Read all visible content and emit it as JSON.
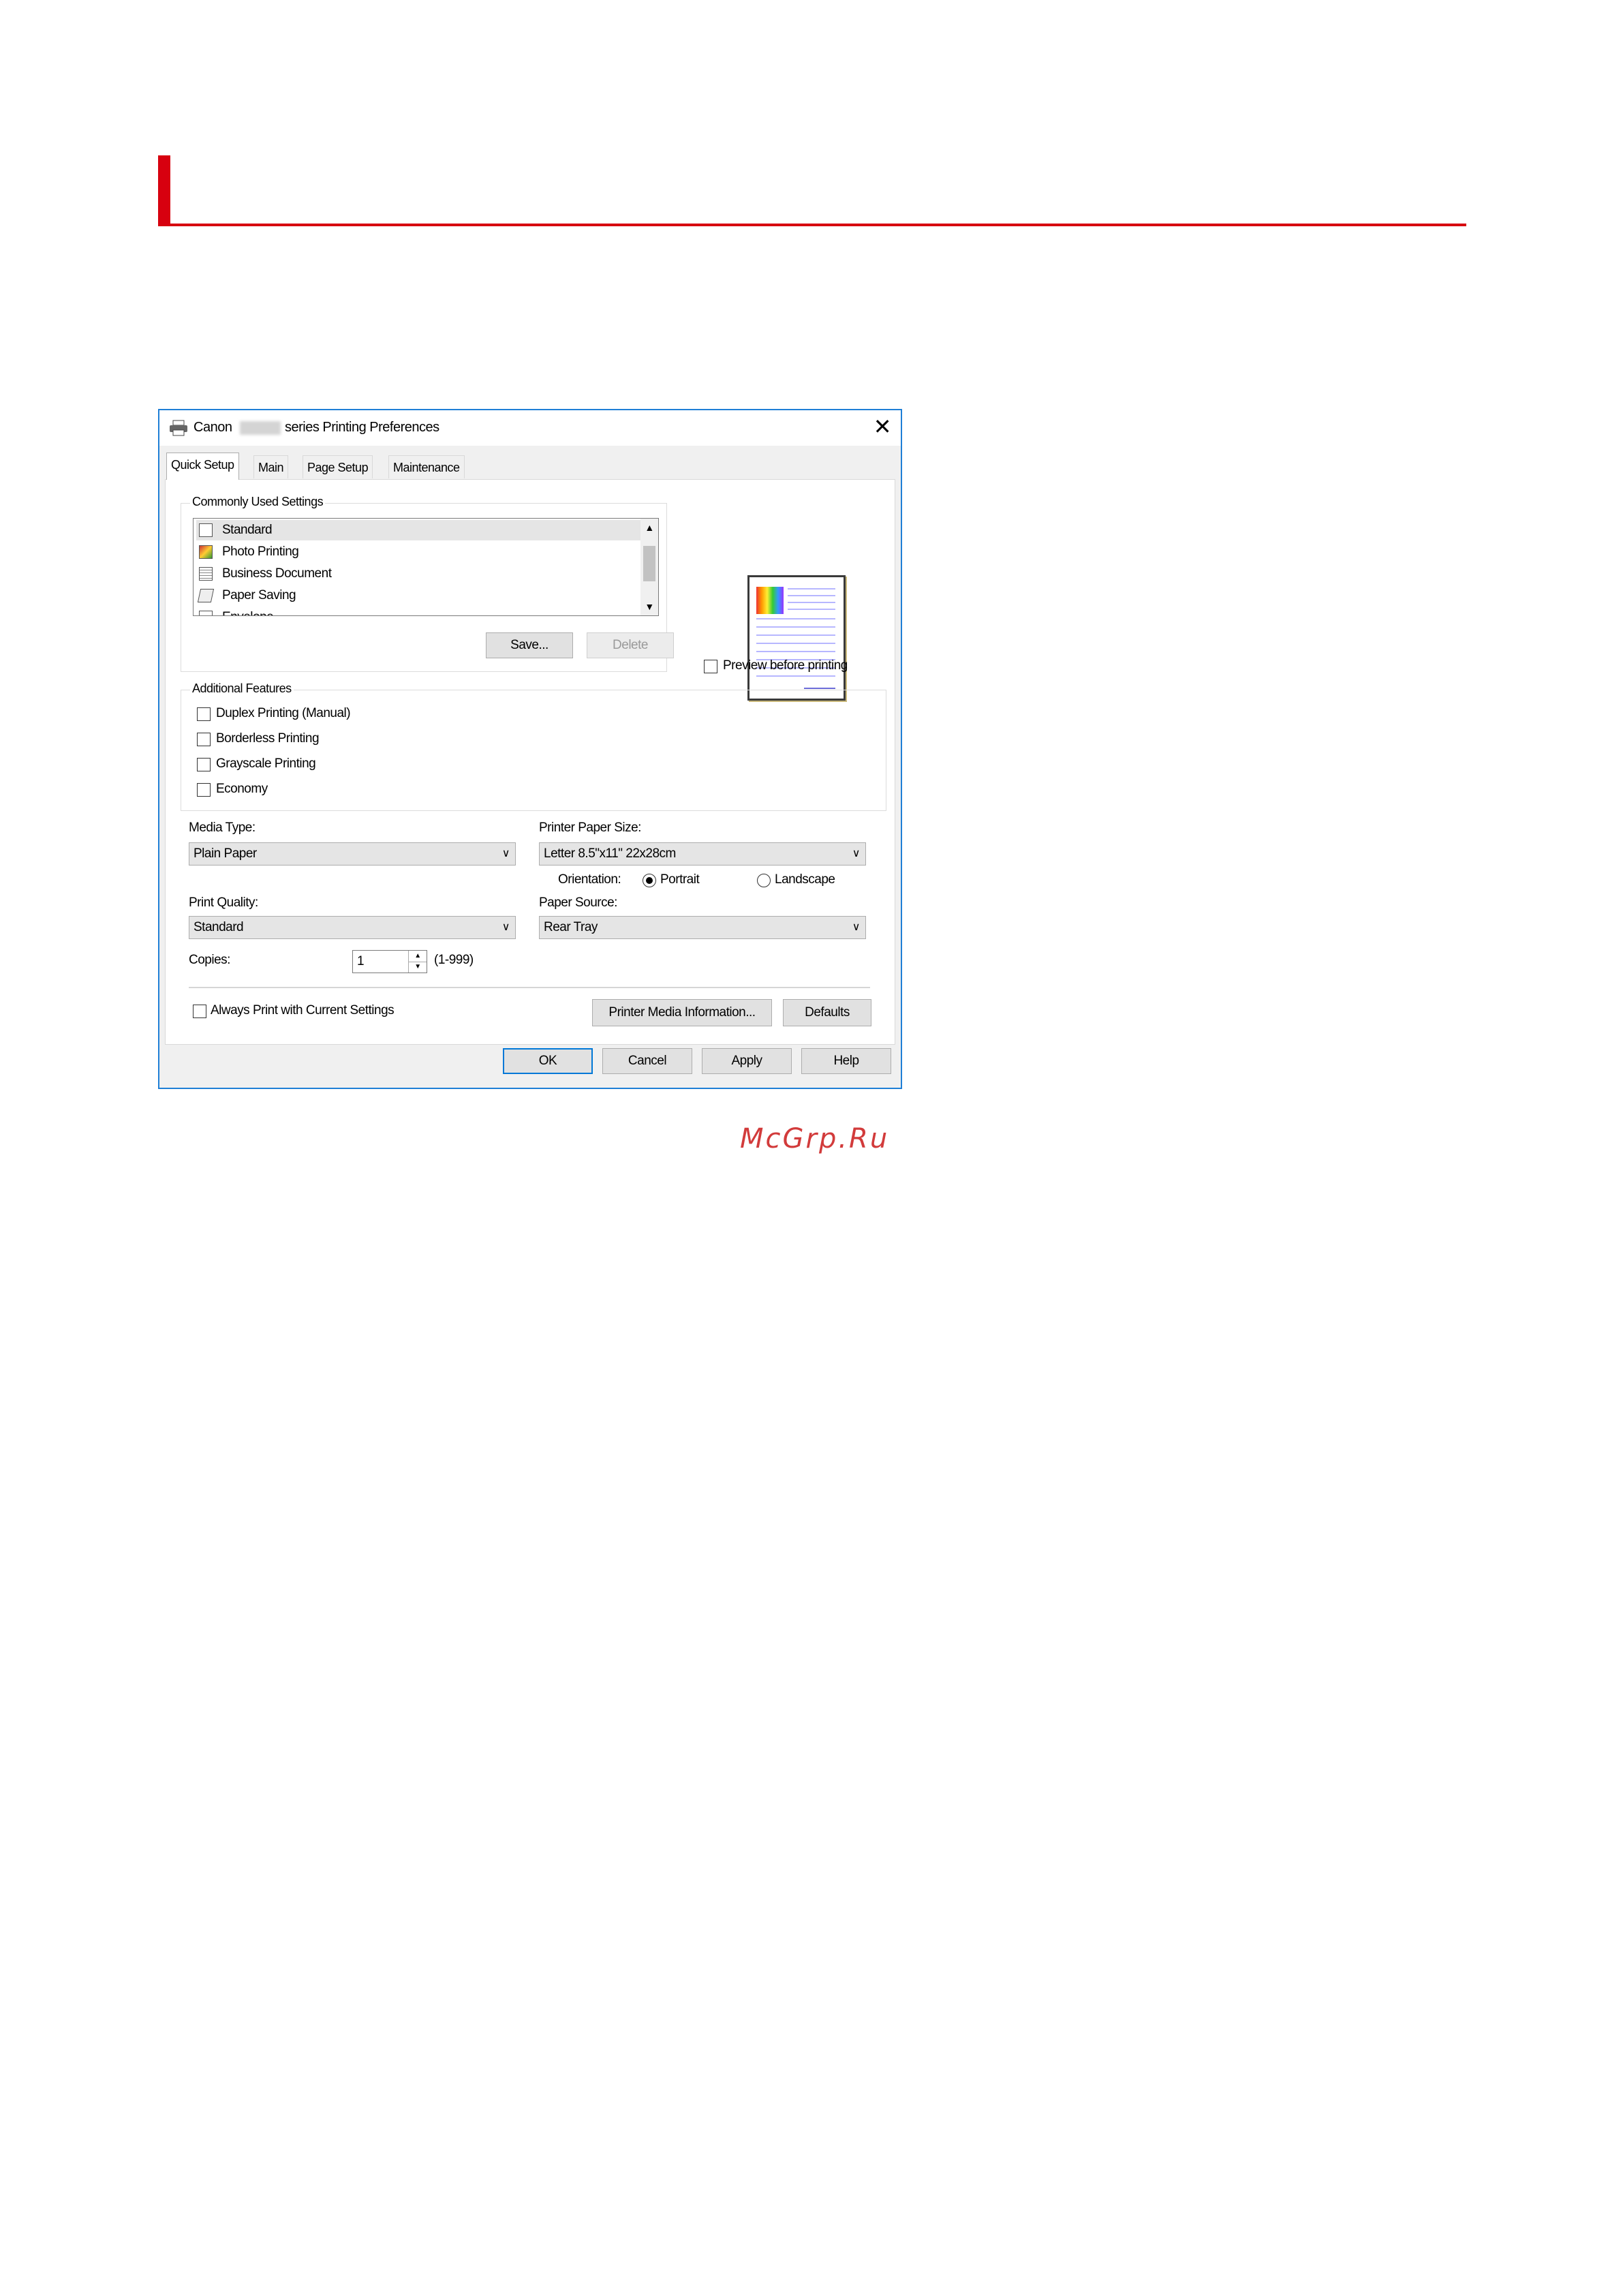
{
  "dialog": {
    "title_prefix": "Canon",
    "title_suffix": "series Printing Preferences",
    "close_glyph": "✕",
    "tabs": [
      {
        "label": "Quick Setup",
        "active": true
      },
      {
        "label": "Main",
        "active": false
      },
      {
        "label": "Page Setup",
        "active": false
      },
      {
        "label": "Maintenance",
        "active": false
      }
    ],
    "commonly_used": {
      "title": "Commonly Used Settings",
      "items": [
        {
          "label": "Standard",
          "icon": "standard-doc-icon",
          "selected": true
        },
        {
          "label": "Photo Printing",
          "icon": "photo-icon",
          "selected": false
        },
        {
          "label": "Business Document",
          "icon": "business-doc-icon",
          "selected": false
        },
        {
          "label": "Paper Saving",
          "icon": "paper-saving-icon",
          "selected": false
        },
        {
          "label": "Envelope",
          "icon": "envelope-icon",
          "selected": false
        }
      ],
      "save_label": "Save...",
      "delete_label": "Delete"
    },
    "preview_before_printing": "Preview before printing",
    "additional_features": {
      "title": "Additional Features",
      "items": [
        {
          "label": "Duplex Printing (Manual)",
          "checked": false
        },
        {
          "label": "Borderless Printing",
          "checked": false
        },
        {
          "label": "Grayscale Printing",
          "checked": false
        },
        {
          "label": "Economy",
          "checked": false
        }
      ]
    },
    "media_type": {
      "label": "Media Type:",
      "value": "Plain Paper"
    },
    "paper_size": {
      "label": "Printer Paper Size:",
      "value": "Letter 8.5\"x11\" 22x28cm"
    },
    "orientation": {
      "label": "Orientation:",
      "portrait": "Portrait",
      "landscape": "Landscape",
      "selected": "Portrait"
    },
    "print_quality": {
      "label": "Print Quality:",
      "value": "Standard"
    },
    "paper_source": {
      "label": "Paper Source:",
      "value": "Rear Tray"
    },
    "copies": {
      "label": "Copies:",
      "value": "1",
      "range": "(1-999)"
    },
    "always_print": "Always Print with Current Settings",
    "printer_media_info": "Printer Media Information...",
    "defaults": "Defaults",
    "footer": {
      "ok": "OK",
      "cancel": "Cancel",
      "apply": "Apply",
      "help": "Help"
    }
  },
  "watermark": "McGrp.Ru",
  "colors": {
    "accent": "#d7000f",
    "window_border": "#1f7fd6",
    "watermark": "#d23b3b"
  }
}
